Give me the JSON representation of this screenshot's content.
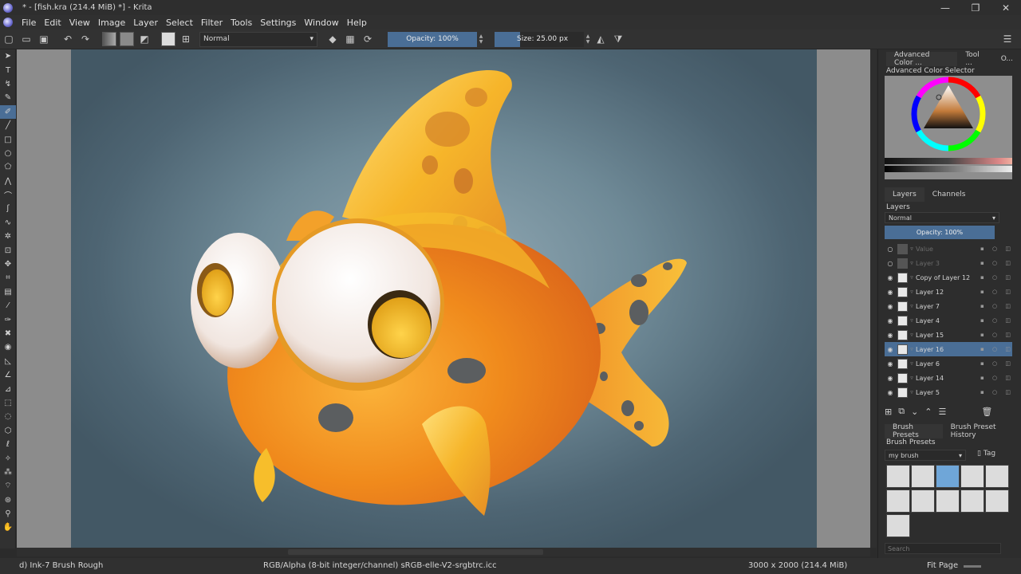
{
  "window": {
    "title": "* - [fish.kra (214.4 MiB) *] - Krita",
    "minimize": "—",
    "restore": "❐",
    "close": "✕"
  },
  "menu": [
    "File",
    "Edit",
    "View",
    "Image",
    "Layer",
    "Select",
    "Filter",
    "Tools",
    "Settings",
    "Window",
    "Help"
  ],
  "toolbar": {
    "blend_mode": "Normal",
    "opacity_label": "Opacity: 100%",
    "size_label": "Size: 25.00 px",
    "opacity_fraction": 1.0
  },
  "dock": {
    "top_tabs": [
      "Advanced Color ...",
      "Tool ...",
      "O..."
    ],
    "color_title": "Advanced Color Selector",
    "layer_tabs": [
      "Layers",
      "Channels"
    ],
    "layers_title": "Layers",
    "layer_blend": "Normal",
    "layer_opacity": "Opacity:  100%",
    "layers": [
      {
        "name": "Value",
        "visible": false,
        "selected": false
      },
      {
        "name": "Layer 3",
        "visible": false,
        "selected": false
      },
      {
        "name": "Copy of Layer 12",
        "visible": true,
        "selected": false
      },
      {
        "name": "Layer 12",
        "visible": true,
        "selected": false
      },
      {
        "name": "Layer 7",
        "visible": true,
        "selected": false
      },
      {
        "name": "Layer 4",
        "visible": true,
        "selected": false
      },
      {
        "name": "Layer 15",
        "visible": true,
        "selected": false
      },
      {
        "name": "Layer 16",
        "visible": true,
        "selected": true
      },
      {
        "name": "Layer 6",
        "visible": true,
        "selected": false
      },
      {
        "name": "Layer 14",
        "visible": true,
        "selected": false
      },
      {
        "name": "Layer 5",
        "visible": true,
        "selected": false
      }
    ],
    "brush_tabs": [
      "Brush Presets",
      "Brush Preset History"
    ],
    "brush_title": "Brush Presets",
    "brush_tag": "my brush",
    "tag_label": "Tag",
    "search_placeholder": "Search"
  },
  "status": {
    "brush": "d) Ink-7 Brush Rough",
    "color_profile": "RGB/Alpha (8-bit integer/channel)  sRGB-elle-V2-srgbtrc.icc",
    "image_size": "3000 x 2000 (214.4 MiB)",
    "zoom": "Fit Page"
  },
  "colors": {
    "accent": "#4a6e96",
    "fish_orange": "#f08a1c",
    "fish_yellow": "#f7c21a",
    "spot_gray": "#5b5e60"
  }
}
